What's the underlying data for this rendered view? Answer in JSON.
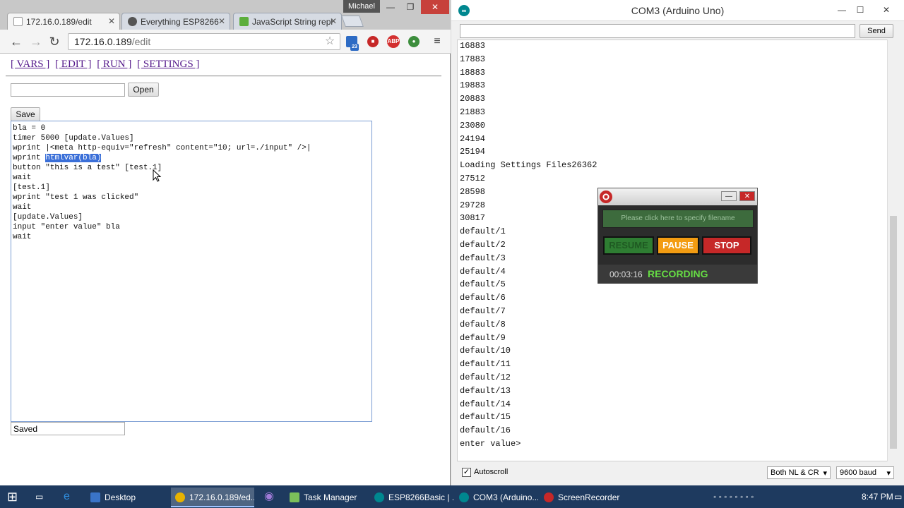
{
  "browser": {
    "profile_name": "Michael",
    "tabs": [
      {
        "label": "172.16.0.189/edit"
      },
      {
        "label": "Everything ESP8266"
      },
      {
        "label": "JavaScript String repl"
      }
    ],
    "url_host": "172.16.0.189",
    "url_path": "/edit",
    "ext_badge": "23"
  },
  "page": {
    "nav": [
      "[ VARS ]",
      "[ EDIT ]",
      "[ RUN ]",
      "[ SETTINGS ]"
    ],
    "filename_value": "",
    "open_label": "Open",
    "save_label": "Save",
    "code_lines": [
      "bla = 0",
      "timer 5000 [update.Values]",
      "wprint |<meta http-equiv=\"refresh\" content=\"10; url=./input\" />|",
      "",
      "button \"this is a test\" [test.1]",
      "wait",
      "",
      "",
      "[test.1]",
      "wprint \"test 1 was clicked\"",
      "wait",
      "",
      "",
      "[update.Values]",
      "input \"enter value\" bla",
      "wait"
    ],
    "code_line4_prefix": "wprint ",
    "code_line4_selected": "htmlvar(bla)",
    "status_value": "Saved"
  },
  "serial": {
    "title": "COM3 (Arduino Uno)",
    "send_label": "Send",
    "lines": [
      "16883",
      "17883",
      "18883",
      "19883",
      "20883",
      "21883",
      "23080",
      "24194",
      "25194",
      "Loading Settings Files26362",
      "27512",
      "28598",
      "29728",
      "30817",
      "default/1",
      "default/2",
      "default/3",
      "default/4",
      "default/5",
      "default/6",
      "default/7",
      "default/8",
      "default/9",
      "default/10",
      "default/11",
      "default/12",
      "default/13",
      "default/14",
      "default/15",
      "default/16",
      "enter value>"
    ],
    "autoscroll_label": "Autoscroll",
    "autoscroll_checked": "✓",
    "line_ending": "Both NL & CR",
    "baud": "9600 baud"
  },
  "recorder": {
    "filename_placeholder": "Please click here to specify filename",
    "resume_label": "RESUME",
    "pause_label": "PAUSE",
    "stop_label": "STOP",
    "elapsed": "00:03:16",
    "status": "RECORDING"
  },
  "taskbar": {
    "items": [
      {
        "label": "Desktop"
      },
      {
        "label": "172.16.0.189/ed..."
      },
      {
        "label": "Task Manager"
      },
      {
        "label": "ESP8266Basic | ..."
      },
      {
        "label": "COM3 (Arduino..."
      },
      {
        "label": "ScreenRecorder"
      }
    ],
    "clock": "8:47 PM"
  },
  "colors": {
    "selection": "#3a6fd8",
    "resume_green": "#2e7d32",
    "pause_orange": "#f39c12",
    "stop_red": "#c62828",
    "recording_green": "#66dd44"
  }
}
